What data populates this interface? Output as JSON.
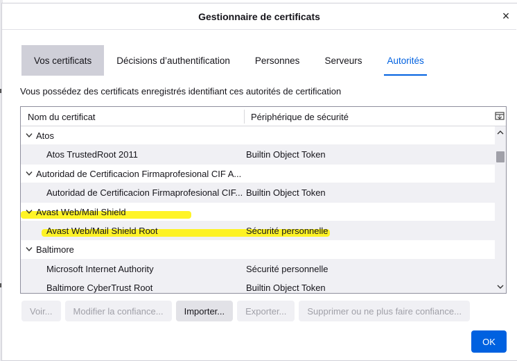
{
  "dialog": {
    "title": "Gestionnaire de certificats",
    "close_label": "×"
  },
  "tabs": [
    {
      "label": "Vos certificats"
    },
    {
      "label": "Décisions d’authentification"
    },
    {
      "label": "Personnes"
    },
    {
      "label": "Serveurs"
    },
    {
      "label": "Autorités"
    }
  ],
  "description": "Vous possédez des certificats enregistrés identifiant ces autorités de certification",
  "table": {
    "columns": [
      "Nom du certificat",
      "Périphérique de sécurité"
    ],
    "rows": [
      {
        "type": "group",
        "name": "Atos",
        "device": ""
      },
      {
        "type": "child",
        "name": "Atos TrustedRoot 2011",
        "device": "Builtin Object Token"
      },
      {
        "type": "group",
        "name": "Autoridad de Certificacion Firmaprofesional CIF A...",
        "device": ""
      },
      {
        "type": "child",
        "name": "Autoridad de Certificacion Firmaprofesional CIF...",
        "device": "Builtin Object Token"
      },
      {
        "type": "group",
        "name": "Avast Web/Mail Shield",
        "device": ""
      },
      {
        "type": "child",
        "name": "Avast Web/Mail Shield Root",
        "device": "Sécurité personnelle"
      },
      {
        "type": "group",
        "name": "Baltimore",
        "device": ""
      },
      {
        "type": "child",
        "name": "Microsoft Internet Authority",
        "device": "Sécurité personnelle"
      },
      {
        "type": "child",
        "name": "Baltimore CyberTrust Root",
        "device": "Builtin Object Token"
      }
    ]
  },
  "buttons": {
    "view": "Voir...",
    "edit_trust": "Modifier la confiance...",
    "import": "Importer...",
    "export": "Exporter...",
    "delete": "Supprimer ou ne plus faire confiance...",
    "ok": "OK"
  },
  "colors": {
    "accent": "#0061e0",
    "highlight": "#fff200",
    "selected_tab_bg": "#cfcfd8"
  }
}
